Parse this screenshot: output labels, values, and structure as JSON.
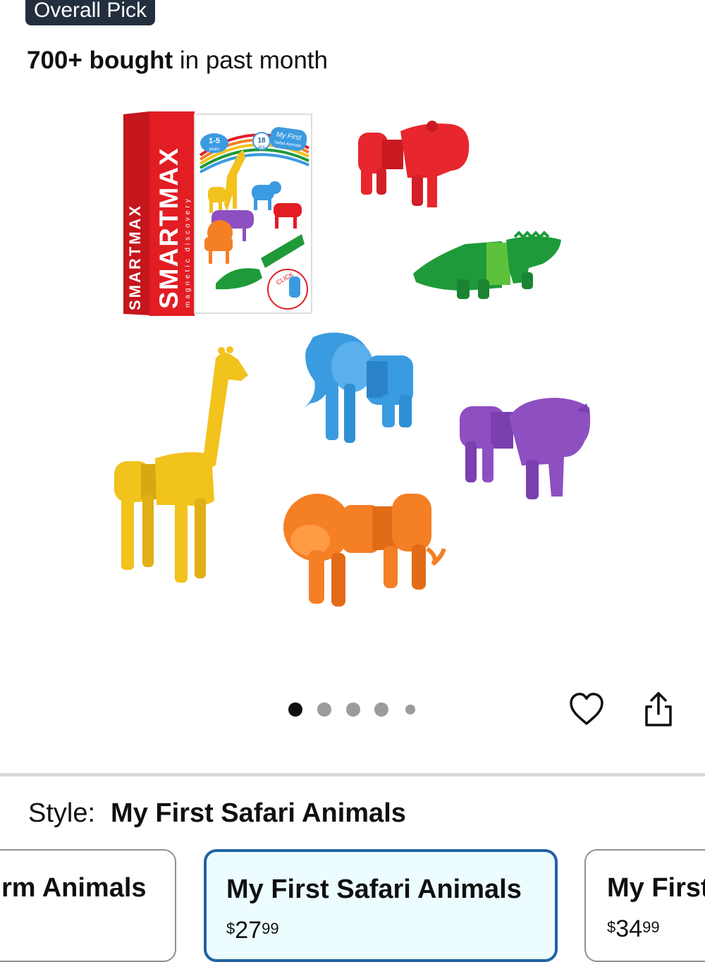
{
  "badge": {
    "label": "Overall Pick"
  },
  "purchase_info": {
    "count": "700+ bought",
    "suffix": " in past month"
  },
  "product_image": {
    "box_brand_side": "SMARTMAX",
    "box_brand_front": "SMARTMAX",
    "box_tagline": "magnetic discovery",
    "box_age": "1-5",
    "box_age_unit": "years",
    "box_pieces": "18",
    "box_pieces_unit": "pcs",
    "box_title_line1": "My First",
    "box_title_line2": "Safari Animals",
    "box_click": "CLICK",
    "animal_colors": {
      "hippo": "#e8262e",
      "crocodile": "#1f9a3a",
      "elephant": "#3b9be0",
      "giraffe": "#f2c21d",
      "rhino": "#8e4fc0",
      "lion": "#f57f25"
    }
  },
  "carousel": {
    "total": 5,
    "active_index": 0
  },
  "actions": {
    "favorite_icon": "heart-outline-icon",
    "share_icon": "share-icon"
  },
  "style_selector": {
    "label": "Style:",
    "selected_value": "My First Safari Animals",
    "options": [
      {
        "name": "My First Farm Animals",
        "visible_name": "rm Animals"
      },
      {
        "name": "My First Safari Animals",
        "price_symbol": "$",
        "price_whole": "27",
        "price_fraction": "99"
      },
      {
        "name": "My First",
        "price_symbol": "$",
        "price_whole": "34",
        "price_fraction": "99"
      }
    ]
  },
  "colors": {
    "badge_bg": "#232f3e",
    "selected_border": "#2162a1",
    "selected_bg": "#edfdff",
    "divider": "#d5d9d9"
  }
}
